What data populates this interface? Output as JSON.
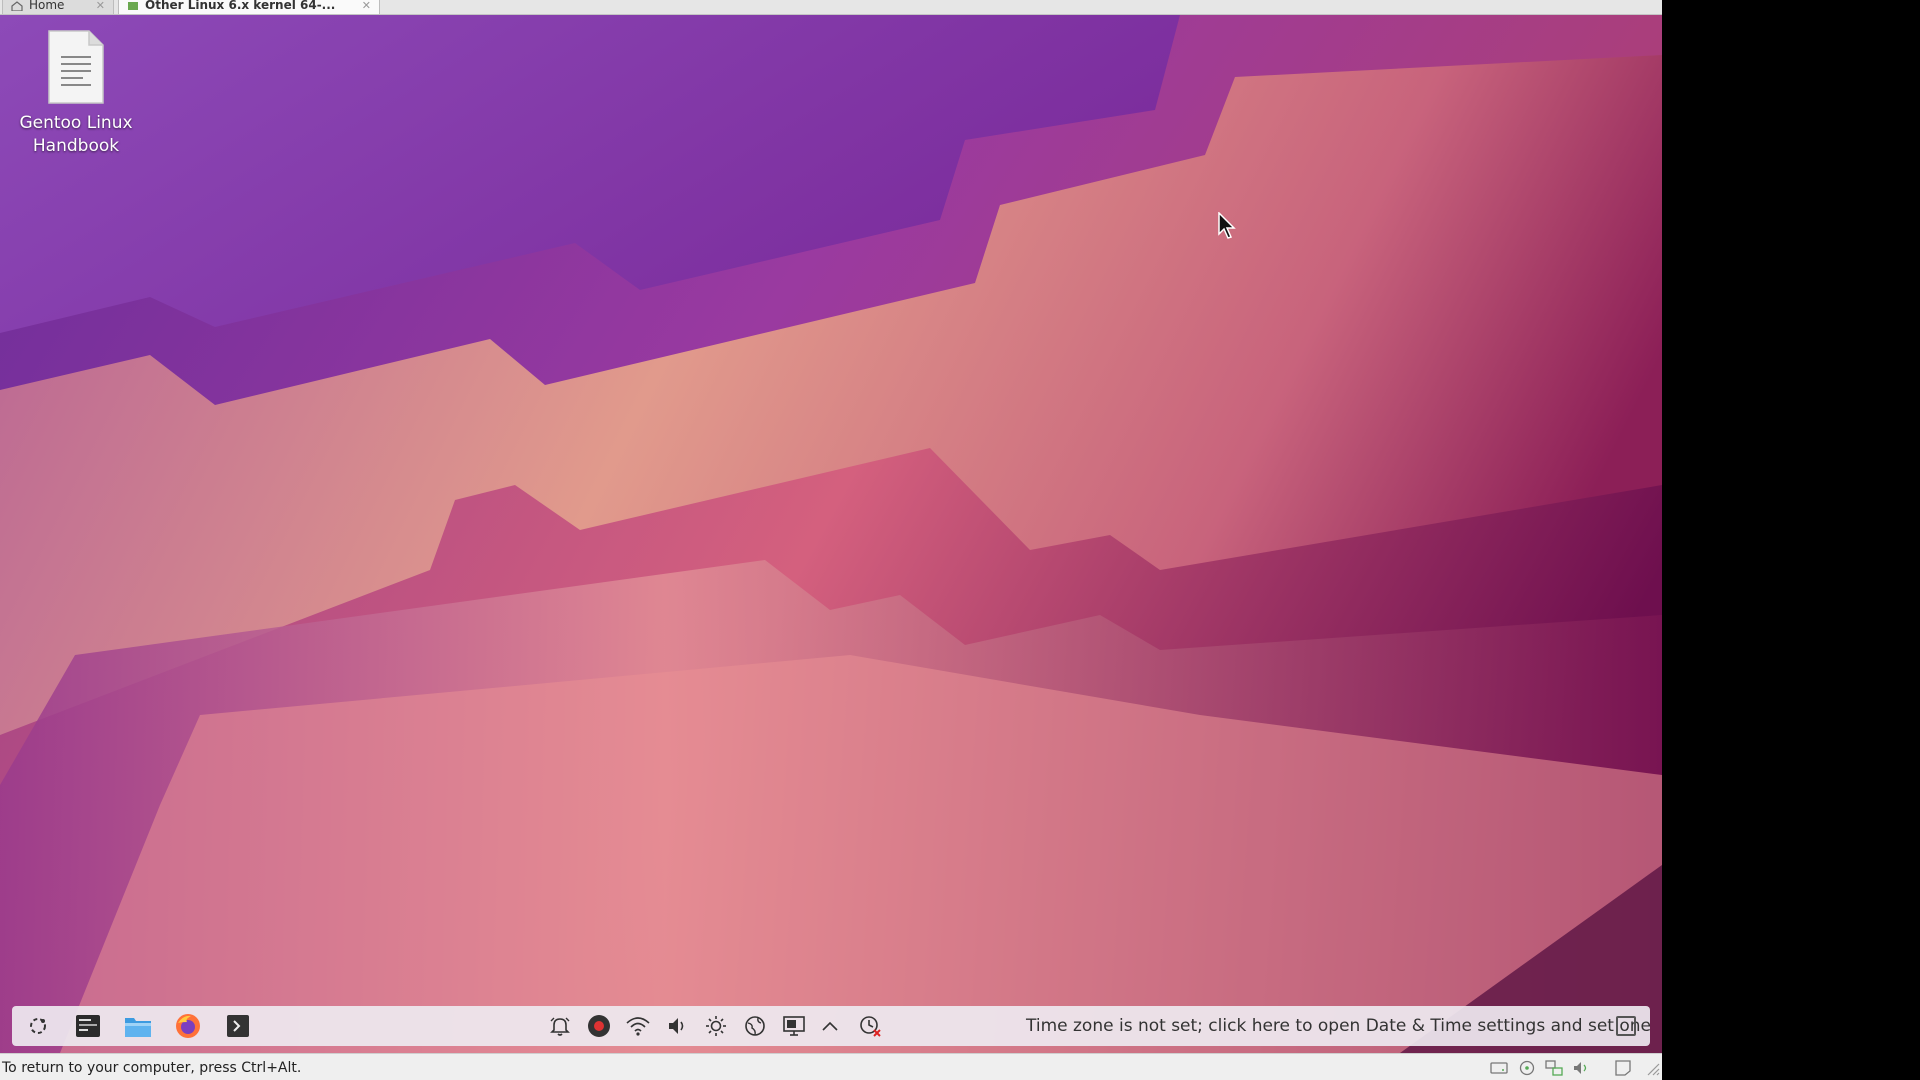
{
  "host": {
    "tabs": [
      {
        "label": "Home",
        "close": "✕"
      },
      {
        "label": "Other Linux 6.x kernel 64-...",
        "close": "✕"
      }
    ],
    "status_text": "To return to your computer, press Ctrl+Alt."
  },
  "desktop": {
    "icons": [
      {
        "label": "Gentoo Linux Handbook",
        "icon": "text-document-icon"
      }
    ]
  },
  "panel": {
    "launchers": [
      {
        "name": "app-launcher-icon"
      },
      {
        "name": "konsole-icon"
      },
      {
        "name": "file-manager-icon"
      },
      {
        "name": "firefox-icon"
      },
      {
        "name": "terminal-icon"
      }
    ],
    "tray": [
      {
        "name": "notifications-icon"
      },
      {
        "name": "record-icon"
      },
      {
        "name": "wifi-icon"
      },
      {
        "name": "volume-icon"
      },
      {
        "name": "brightness-icon"
      },
      {
        "name": "network-globe-icon"
      },
      {
        "name": "display-icon"
      },
      {
        "name": "expand-tray-icon"
      },
      {
        "name": "timezone-warning-icon"
      }
    ],
    "timezone_message": "Time zone is not set; click here to open Date & Time settings and set one"
  },
  "colors": {
    "panel_bg": "#eee9f0",
    "wall_purple": "#7a2fa0",
    "wall_peach": "#e39a86",
    "wall_magenta": "#8e2068"
  }
}
